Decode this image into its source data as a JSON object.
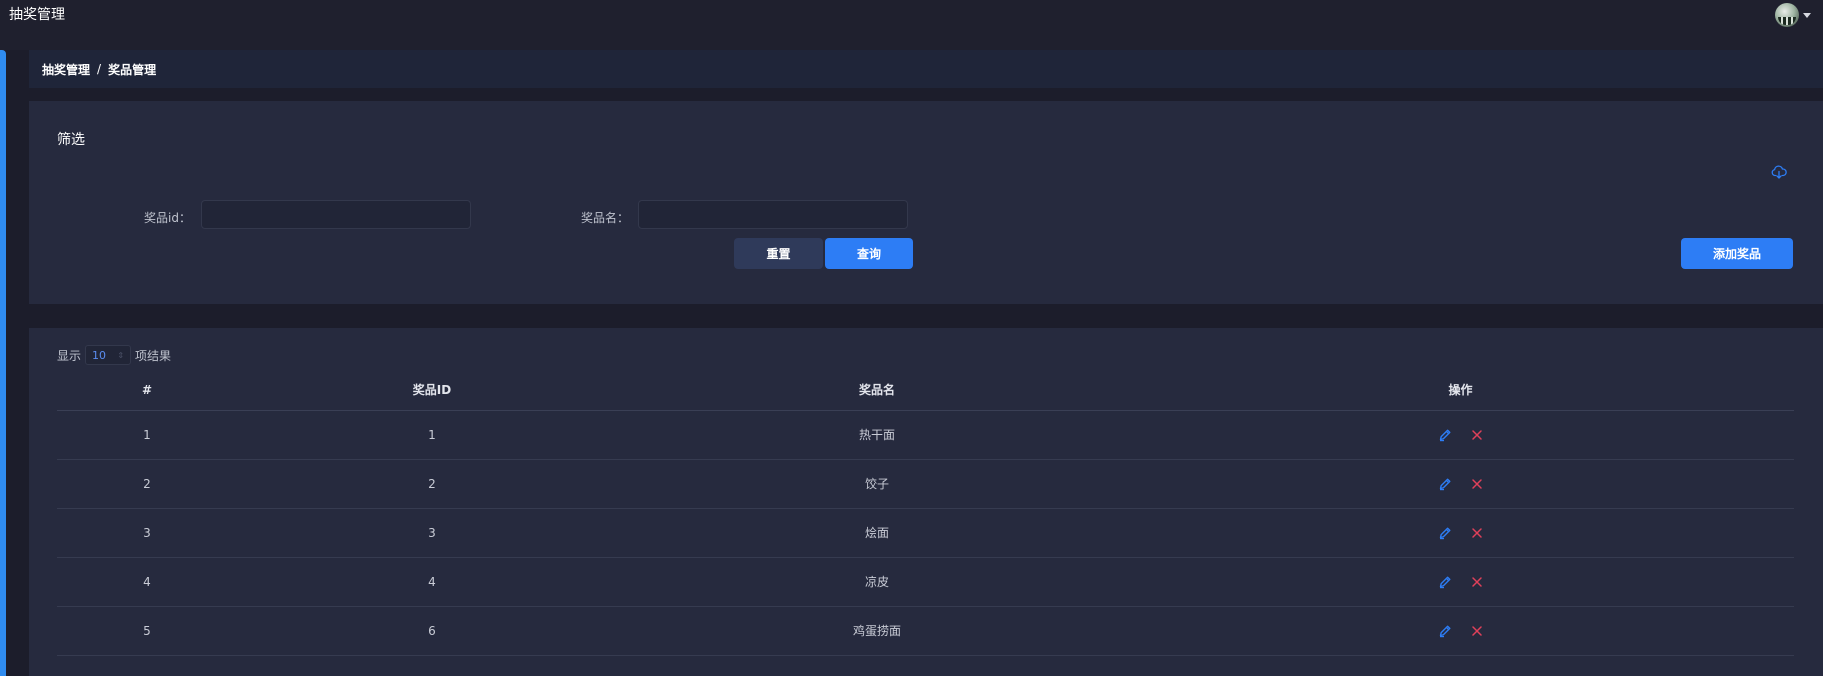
{
  "app": {
    "title": "抽奖管理"
  },
  "breadcrumb": {
    "parent": "抽奖管理",
    "separator": "/",
    "current": "奖品管理"
  },
  "filter": {
    "title": "筛选",
    "fields": [
      {
        "label": "奖品id：",
        "value": "",
        "placeholder": ""
      },
      {
        "label": "奖品名：",
        "value": "",
        "placeholder": ""
      }
    ],
    "reset_label": "重置",
    "query_label": "查询",
    "add_label": "添加奖品",
    "export_icon": "cloud-download-icon"
  },
  "table": {
    "show_label": "显示",
    "page_size": "10",
    "result_label": "项结果",
    "columns": [
      "#",
      "奖品ID",
      "奖品名",
      "操作"
    ],
    "rows": [
      {
        "index": "1",
        "id": "1",
        "name": "热干面"
      },
      {
        "index": "2",
        "id": "2",
        "name": "饺子"
      },
      {
        "index": "3",
        "id": "3",
        "name": "烩面"
      },
      {
        "index": "4",
        "id": "4",
        "name": "凉皮"
      },
      {
        "index": "5",
        "id": "6",
        "name": "鸡蛋捞面"
      }
    ],
    "edit_icon": "pencil-icon",
    "delete_icon": "close-icon"
  },
  "colors": {
    "accent": "#2d7df5",
    "delete": "#e0405a",
    "background": "#1c1d2b",
    "card": "#262a3e"
  }
}
